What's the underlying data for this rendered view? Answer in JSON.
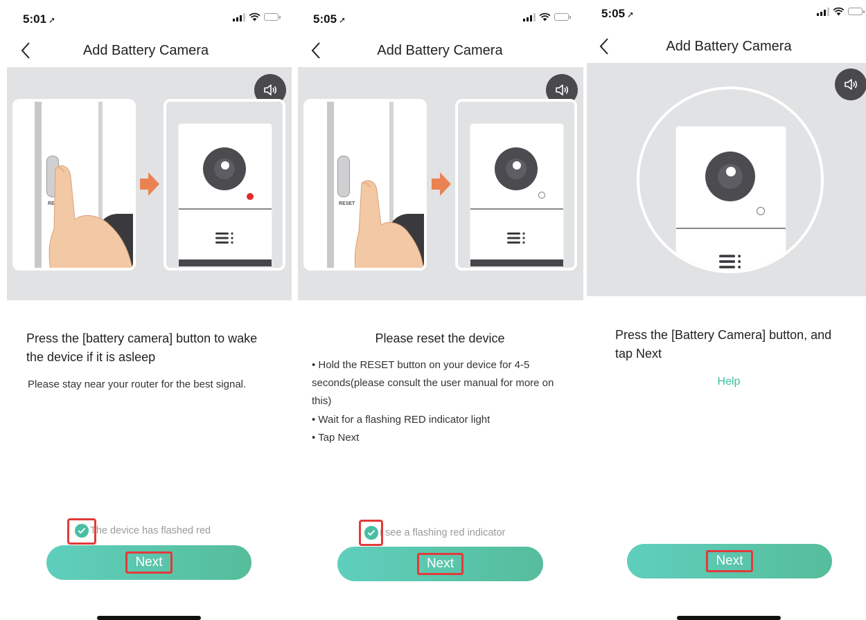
{
  "colors": {
    "accent": "#56c3a6",
    "highlight": "#e23a3a",
    "illustration_bg": "#e1e2e4",
    "indicator_red": "#e02c2c"
  },
  "screens": [
    {
      "status_time": "5:01",
      "title": "Add Battery Camera",
      "button_label": "RE",
      "heading": "Press the [battery camera] button to wake the device if it is  asleep",
      "subtext": "Please stay near your router for the best signal.",
      "checkbox_label": "The device has flashed red",
      "next_label": "Next"
    },
    {
      "status_time": "5:05",
      "title": "Add Battery Camera",
      "button_label": "RESET",
      "heading": "Please reset the device",
      "bullets": [
        "• Hold the RESET button on your device for 4-5 seconds(please consult the user manual for more on this)",
        "• Wait for a flashing RED indicator light",
        "• Tap Next"
      ],
      "checkbox_label": "I see a flashing red indicator",
      "next_label": "Next"
    },
    {
      "status_time": "5:05",
      "title": "Add Battery Camera",
      "heading": "Press the [Battery Camera] button, and tap Next",
      "help_label": "Help",
      "next_label": "Next"
    }
  ],
  "icons": {
    "back": "chevron-left-icon",
    "speaker": "speaker-icon",
    "check": "checkmark-circle-icon",
    "signal": "cellular-signal-icon",
    "wifi": "wifi-icon",
    "battery": "battery-icon",
    "location": "location-arrow-icon"
  }
}
